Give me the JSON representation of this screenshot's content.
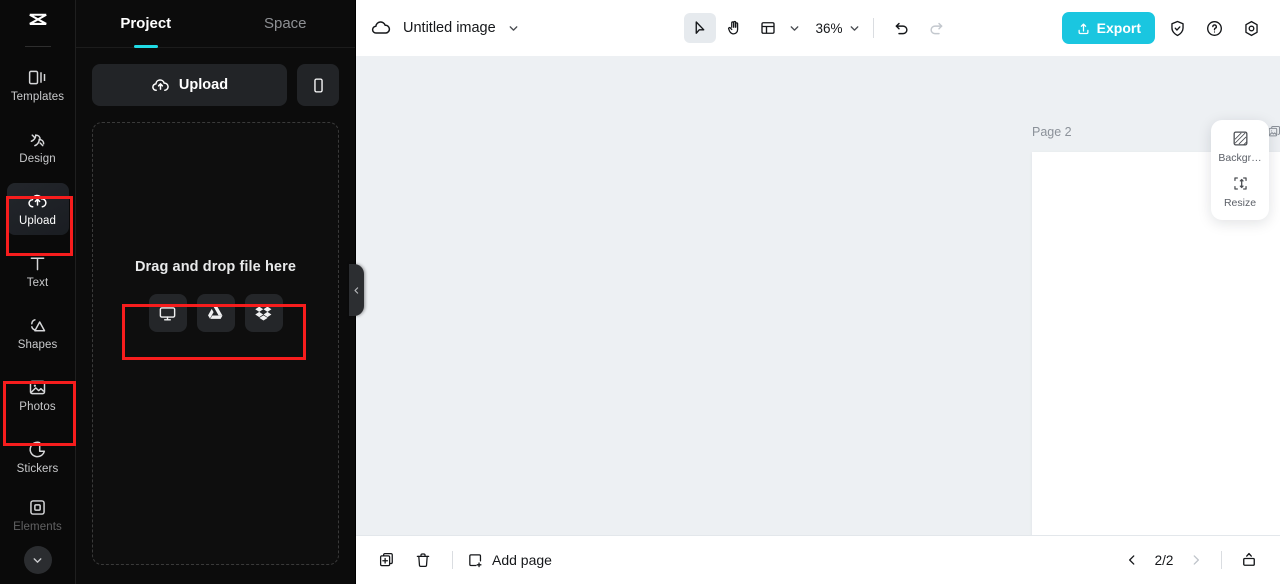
{
  "brand": {
    "logo_name": "capcut-logo",
    "accent": "#20dbe5",
    "export_color": "#1ac6e0"
  },
  "rail": {
    "items": [
      {
        "label": "Templates",
        "icon": "templates-icon",
        "active": false
      },
      {
        "label": "Design",
        "icon": "design-icon",
        "active": false
      },
      {
        "label": "Upload",
        "icon": "upload-cloud-icon",
        "active": true
      },
      {
        "label": "Text",
        "icon": "text-icon",
        "active": false
      },
      {
        "label": "Shapes",
        "icon": "shapes-icon",
        "active": false
      },
      {
        "label": "Photos",
        "icon": "photos-icon",
        "active": false
      },
      {
        "label": "Stickers",
        "icon": "stickers-icon",
        "active": false
      },
      {
        "label": "Elements",
        "icon": "elements-icon",
        "active": false
      }
    ],
    "more_icon": "chevron-down-icon"
  },
  "panel": {
    "tabs": [
      {
        "label": "Project",
        "active": true
      },
      {
        "label": "Space",
        "active": false
      }
    ],
    "upload_label": "Upload",
    "phone_icon": "mobile-phone-icon",
    "dropzone_text": "Drag and drop file here",
    "sources": [
      {
        "name": "computer",
        "icon": "desktop-monitor-icon"
      },
      {
        "name": "google-drive",
        "icon": "google-drive-icon"
      },
      {
        "name": "dropbox",
        "icon": "dropbox-icon"
      }
    ],
    "collapse_icon": "chevron-left-icon"
  },
  "topbar": {
    "cloud_icon": "cloud-icon",
    "doc_title": "Untitled image",
    "title_caret": "chevron-down-icon",
    "tools": [
      {
        "name": "select-tool",
        "icon": "cursor-arrow-icon",
        "selected": true
      },
      {
        "name": "hand-tool",
        "icon": "hand-icon",
        "selected": false
      },
      {
        "name": "layout-tool",
        "icon": "layout-grid-icon",
        "selected": false
      }
    ],
    "layout_caret": "chevron-down-icon",
    "zoom_level": "36%",
    "zoom_caret": "chevron-down-icon",
    "undo_icon": "undo-arrow-icon",
    "redo_icon": "redo-arrow-icon",
    "export_label": "Export",
    "export_icon": "export-upload-icon",
    "right_icons": [
      {
        "name": "shield-check-icon"
      },
      {
        "name": "help-question-icon"
      },
      {
        "name": "settings-gear-icon"
      }
    ]
  },
  "canvas": {
    "page_label": "Page 2",
    "page_copy_icon": "duplicate-page-icon",
    "page_more_icon": "more-options-icon",
    "more_dots": "•••"
  },
  "float_panel": {
    "items": [
      {
        "label": "Backgr…",
        "icon": "background-pattern-icon"
      },
      {
        "label": "Resize",
        "icon": "resize-icon"
      }
    ]
  },
  "bottombar": {
    "duplicate_icon": "duplicate-icon",
    "delete_icon": "trash-icon",
    "add_page_label": "Add page",
    "add_page_icon": "add-page-icon",
    "prev_icon": "chevron-left-icon",
    "next_icon": "chevron-right-icon",
    "page_indicator": "2/2",
    "expand_icon": "expand-panel-icon"
  }
}
